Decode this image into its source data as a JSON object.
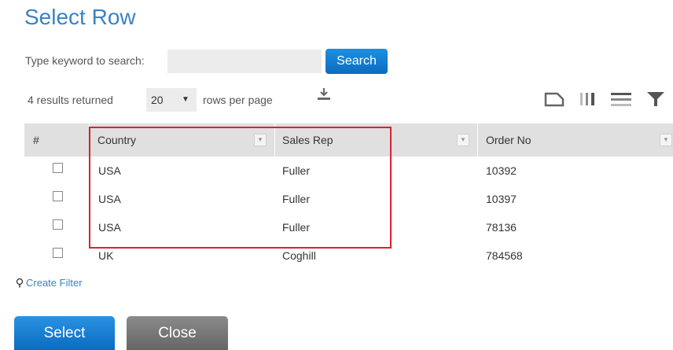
{
  "title": "Select Row",
  "search": {
    "label": "Type keyword to search:",
    "value": "",
    "placeholder": "",
    "button_label": "Search"
  },
  "results_text": "4 results returned",
  "rows_per_page": {
    "selected": "20",
    "arrow": "▼",
    "label": "rows per page"
  },
  "toolbar_icons": [
    "download-icon",
    "layout-icon",
    "columns-icon",
    "rows-icon",
    "filter-icon"
  ],
  "grid": {
    "columns": [
      {
        "label": "#",
        "menu": ""
      },
      {
        "label": "Country",
        "menu": "▼"
      },
      {
        "label": "Sales Rep",
        "menu": "▼"
      },
      {
        "label": "Order No",
        "menu": "▼"
      }
    ],
    "rows": [
      {
        "country": "USA",
        "sales_rep": "Fuller",
        "order_no": "10392",
        "checked": false
      },
      {
        "country": "USA",
        "sales_rep": "Fuller",
        "order_no": "10397",
        "checked": false
      },
      {
        "country": "USA",
        "sales_rep": "Fuller",
        "order_no": "78136",
        "checked": false
      },
      {
        "country": "UK",
        "sales_rep": "Coghill",
        "order_no": "784568",
        "checked": false
      }
    ]
  },
  "create_filter_label": "Create Filter",
  "buttons": {
    "select": "Select",
    "close": "Close"
  },
  "colors": {
    "accent": "#3a82c4",
    "primary_button": "#0b6cc0",
    "secondary_button": "#777777",
    "highlight_border": "#d9232e",
    "header_bg": "#e0e0e0"
  }
}
